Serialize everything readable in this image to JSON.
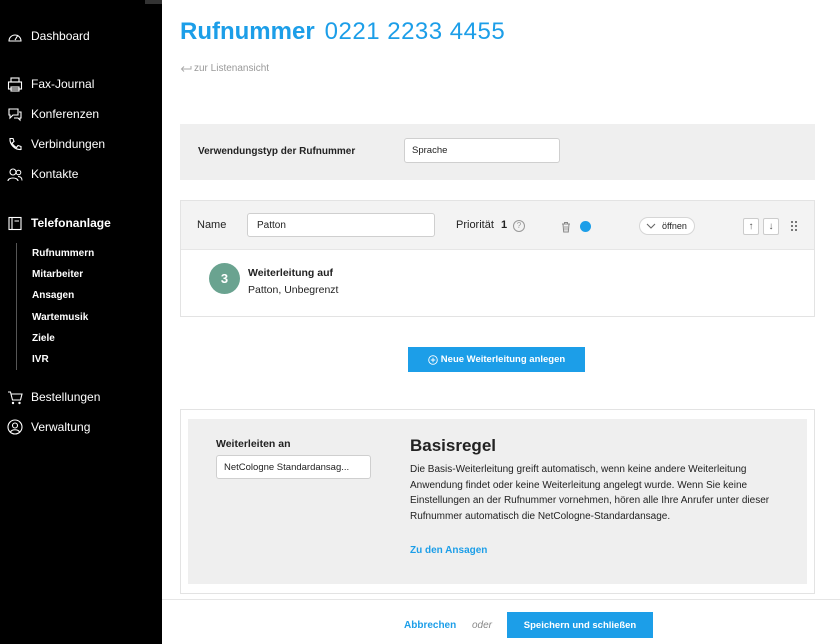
{
  "sidebar": {
    "items": [
      {
        "label": "Dashboard",
        "icon": "gauge-icon"
      },
      {
        "label": "Fax-Journal",
        "icon": "fax-icon"
      },
      {
        "label": "Konferenzen",
        "icon": "conference-icon"
      },
      {
        "label": "Verbindungen",
        "icon": "phone-icon"
      },
      {
        "label": "Kontakte",
        "icon": "contacts-icon"
      },
      {
        "label": "Telefonanlage",
        "icon": "telephone-system-icon"
      },
      {
        "label": "Bestellungen",
        "icon": "cart-icon"
      },
      {
        "label": "Verwaltung",
        "icon": "user-icon"
      }
    ],
    "subitems": [
      "Rufnummern",
      "Mitarbeiter",
      "Ansagen",
      "Wartemusik",
      "Ziele",
      "IVR"
    ]
  },
  "header": {
    "title": "Rufnummer",
    "number": "0221 2233 4455",
    "back_link": "zur Listenansicht"
  },
  "usage": {
    "label": "Verwendungstyp der Rufnummer",
    "value": "Sprache"
  },
  "forwarding_card": {
    "name_label": "Name",
    "name_value": "Patton",
    "priority_label": "Priorität",
    "priority_value": "1",
    "open_label": "öffnen",
    "up_arrow": "↑",
    "down_arrow": "↓",
    "step_number": "3",
    "title": "Weiterleitung auf",
    "subtitle": "Patton, Unbegrenzt"
  },
  "new_forwarding_button": "Neue Weiterleitung anlegen",
  "basis": {
    "forward_label": "Weiterleiten an",
    "forward_value": "NetCologne Standardansag...",
    "title": "Basisregel",
    "text": "Die Basis-Weiterleitung greift automatisch, wenn keine andere Weiterleitung Anwendung findet oder keine Weiterleitung angelegt wurde. Wenn Sie keine Einstellungen an der Rufnummer vornehmen, hören alle Ihre Anrufer unter dieser Rufnummer automatisch die NetCologne-Standardansage.",
    "link": "Zu den Ansagen"
  },
  "footer": {
    "cancel": "Abbrechen",
    "or": "oder",
    "save": "Speichern und schließen"
  },
  "colors": {
    "accent": "#1c9ee8",
    "sidebar": "#000000",
    "step_circle": "#6aa390",
    "panel": "#efefef"
  }
}
